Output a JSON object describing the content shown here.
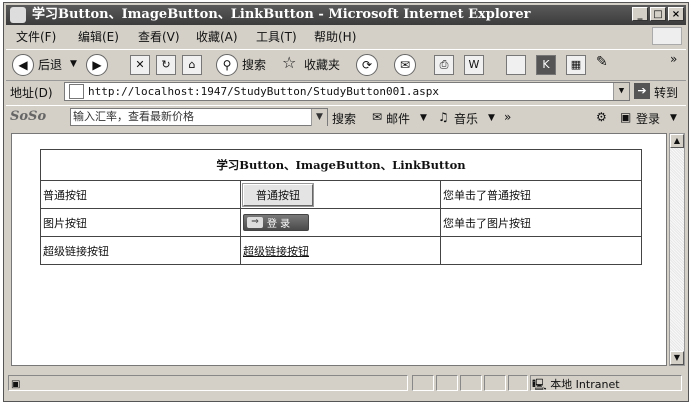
{
  "window": {
    "title": "学习Button、ImageButton、LinkButton - Microsoft Internet Explorer",
    "controls": [
      "_",
      "□",
      "×"
    ]
  },
  "menu": [
    "文件(F)",
    "编辑(E)",
    "查看(V)",
    "收藏(A)",
    "工具(T)",
    "帮助(H)"
  ],
  "toolbar": {
    "back_label": "后退",
    "search_label": "搜索",
    "favorites_label": "收藏夹",
    "overflow": "»"
  },
  "address": {
    "label": "地址(D)",
    "url": "http://localhost:1947/StudyButton/StudyButton001.aspx",
    "go_label": "转到"
  },
  "soso": {
    "logo": "SoSo",
    "placeholder": "输入汇率，查看最新价格",
    "search_label": "搜索",
    "mail_label": "邮件",
    "music_label": "音乐",
    "more": "»",
    "login_label": "登录"
  },
  "page": {
    "table_title": "学习Button、ImageButton、LinkButton",
    "rows": [
      {
        "label": "普通按钮",
        "control": "普通按钮",
        "result": "您单击了普通按钮"
      },
      {
        "label": "图片按钮",
        "control": "登 录",
        "result": "您单击了图片按钮"
      },
      {
        "label": "超级链接按钮",
        "control": "超级链接按钮",
        "result": ""
      }
    ]
  },
  "status": {
    "zone": "本地 Intranet"
  }
}
